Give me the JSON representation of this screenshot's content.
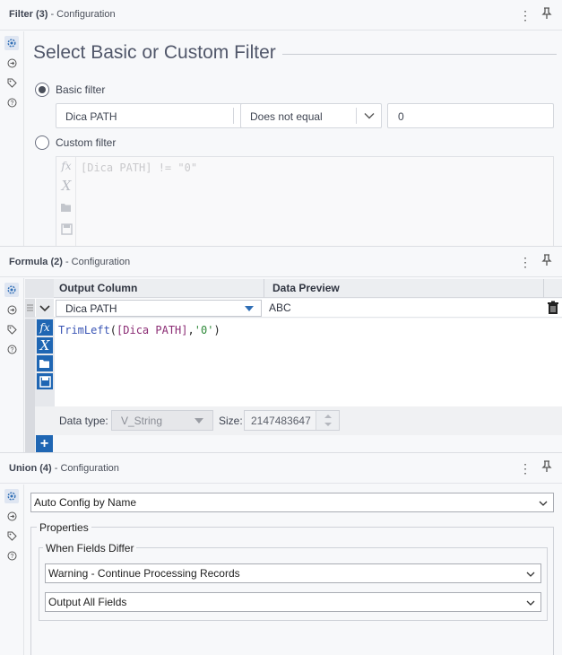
{
  "filter_panel": {
    "title_bold": "Filter (3)",
    "title_rest": " - Configuration",
    "heading": "Select Basic or Custom Filter",
    "basic_label": "Basic filter",
    "field_value": "Dica PATH",
    "operator_value": "Does not equal",
    "compare_value": "0",
    "custom_label": "Custom filter",
    "expression": "[Dica PATH] != \"0\""
  },
  "formula_panel": {
    "title_bold": "Formula (2)",
    "title_rest": " - Configuration",
    "col_output": "Output Column",
    "col_preview": "Data Preview",
    "output_value": "Dica PATH",
    "preview_value": "ABC",
    "formula_fn": "TrimLeft",
    "formula_open": "(",
    "formula_field": "[Dica PATH]",
    "formula_comma": ",",
    "formula_str": "'0'",
    "formula_close": ")",
    "data_type_label": "Data type:",
    "data_type_value": "V_String",
    "size_label": "Size:",
    "size_value": "2147483647",
    "add_label": "+"
  },
  "union_panel": {
    "title_bold": "Union (4)",
    "title_rest": " - Configuration",
    "auto_config": "Auto Config by Name",
    "properties_label": "Properties",
    "fields_differ_label": "When Fields Differ",
    "warning_option": "Warning - Continue Processing Records",
    "output_option": "Output All Fields"
  },
  "icons": {
    "menu": "⋮",
    "pin": "pin-icon"
  },
  "colors": {
    "accent": "#1f66b3",
    "panel_bg": "#f7f8fa",
    "string_literal": "#2a8a2a",
    "field_ref": "#8a2a6e",
    "function": "#2f4fa0"
  }
}
